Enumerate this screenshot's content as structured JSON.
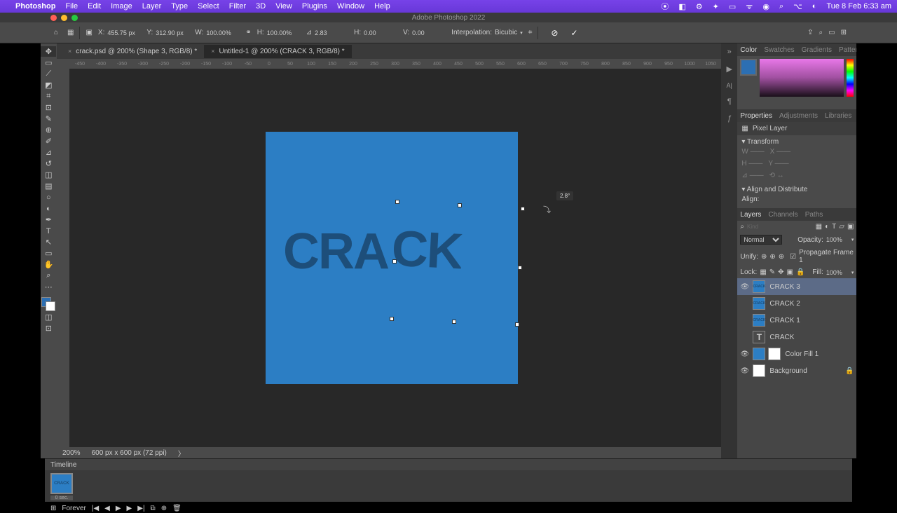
{
  "menubar": {
    "app": "Photoshop",
    "items": [
      "File",
      "Edit",
      "Image",
      "Layer",
      "Type",
      "Select",
      "Filter",
      "3D",
      "View",
      "Plugins",
      "Window",
      "Help"
    ],
    "datetime": "Tue 8 Feb 6:33 am"
  },
  "window_title": "Adobe Photoshop 2022",
  "options": {
    "x_label": "X:",
    "x": "455.75 px",
    "y_label": "Y:",
    "y": "312.90 px",
    "w_label": "W:",
    "w": "100.00%",
    "h_label": "H:",
    "h": "100.00%",
    "angle_label": "⊿",
    "angle": "2.83",
    "hskew_label": "H:",
    "hskew": "0.00",
    "vskew_label": "V:",
    "vskew": "0.00",
    "interp_label": "Interpolation:",
    "interp": "Bicubic"
  },
  "tabs": [
    {
      "label": "crack.psd @ 200% (Shape 3, RGB/8) *",
      "active": false
    },
    {
      "label": "Untitled-1 @ 200% (CRACK 3, RGB/8) *",
      "active": true
    }
  ],
  "ruler_marks": [
    "-450",
    "-400",
    "-350",
    "-300",
    "-250",
    "-200",
    "-150",
    "-100",
    "-50",
    "0",
    "50",
    "100",
    "150",
    "200",
    "250",
    "300",
    "350",
    "400",
    "450",
    "500",
    "550",
    "600",
    "650",
    "700",
    "750",
    "800",
    "850",
    "900",
    "950",
    "1000",
    "1050"
  ],
  "canvas": {
    "text1": "CRA",
    "text2": "CK",
    "tooltip": "2.8°"
  },
  "status": {
    "zoom": "200%",
    "doc": "600 px x 600 px (72 ppi)"
  },
  "color_tabs": [
    "Color",
    "Swatches",
    "Gradients",
    "Patterns"
  ],
  "props_tabs": [
    "Properties",
    "Adjustments",
    "Libraries"
  ],
  "props": {
    "kind": "Pixel Layer",
    "transform_label": "Transform",
    "align_label": "Align and Distribute",
    "align_sub": "Align:"
  },
  "layers_tabs": [
    "Layers",
    "Channels",
    "Paths"
  ],
  "layer_ctrl": {
    "blend": "Normal",
    "opacity_label": "Opacity:",
    "opacity": "100%",
    "lock_label": "Lock:",
    "fill_label": "Fill:",
    "fill": "100%",
    "unify": "Unify:",
    "propagate": "Propagate Frame 1"
  },
  "layers": [
    {
      "name": "CRACK 3",
      "eye": true,
      "sel": true,
      "thumb": "CRACK"
    },
    {
      "name": "CRACK 2",
      "eye": false,
      "thumb": "CRACK"
    },
    {
      "name": "CRACK 1",
      "eye": false,
      "thumb": "CRACK"
    },
    {
      "name": "CRACK",
      "eye": false,
      "type": "T"
    },
    {
      "name": "Color Fill 1",
      "eye": true,
      "mask": true,
      "color": "#2c7ec4"
    },
    {
      "name": "Background",
      "eye": true,
      "color": "#fff",
      "locked": true
    }
  ],
  "timeline": {
    "label": "Timeline",
    "frame_text": "CRACK",
    "frame_time": "0 sec.",
    "forever": "Forever"
  }
}
